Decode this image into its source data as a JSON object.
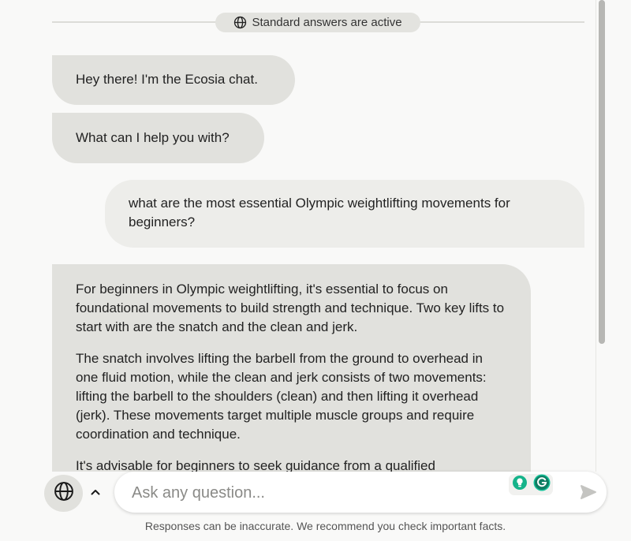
{
  "header": {
    "mode_label": "Standard answers are active",
    "mode_icon": "globe-icon"
  },
  "messages": [
    {
      "role": "assistant",
      "paragraphs": [
        "Hey there! I'm the Ecosia chat."
      ]
    },
    {
      "role": "assistant",
      "paragraphs": [
        "What can I help you with?"
      ]
    },
    {
      "role": "user",
      "paragraphs": [
        "what are the most essential Olympic weightlifting movements for beginners?"
      ]
    },
    {
      "role": "assistant",
      "paragraphs": [
        "For beginners in Olympic weightlifting, it's essential to focus on foundational movements to build strength and technique. Two key lifts to start with are the snatch and the clean and jerk.",
        "The snatch involves lifting the barbell from the ground to overhead in one fluid motion, while the clean and jerk consists of two movements: lifting the barbell to the shoulders (clean) and then lifting it overhead (jerk). These movements target multiple muscle groups and require coordination and technique.",
        "It's advisable for beginners to seek guidance from a qualified"
      ]
    }
  ],
  "composer": {
    "placeholder": "Ask any question...",
    "value": "",
    "mode_icon": "globe-icon",
    "toggle_icon": "chevron-up-icon",
    "send_icon": "send-icon",
    "extension_icons": [
      "lightbulb-icon",
      "grammarly-icon"
    ]
  },
  "footer": {
    "disclaimer": "Responses can be inaccurate. We recommend you check important facts."
  },
  "colors": {
    "background": "#f9f9f8",
    "assistant_bubble": "#e1e1dd",
    "user_bubble": "#ededea",
    "grammarly": "#15c39a"
  }
}
